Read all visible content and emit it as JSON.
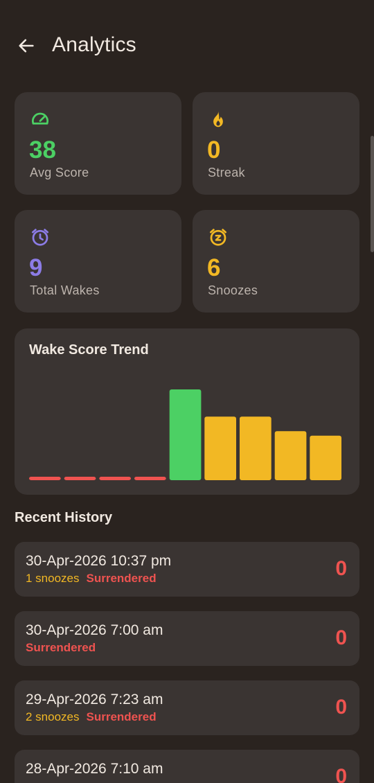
{
  "header": {
    "title": "Analytics"
  },
  "stats": [
    {
      "icon": "speedometer-icon",
      "value": "38",
      "label": "Avg Score",
      "color": "#4cd064"
    },
    {
      "icon": "flame-icon",
      "value": "0",
      "label": "Streak",
      "color": "#f2b824"
    },
    {
      "icon": "alarm-clock-icon",
      "value": "9",
      "label": "Total Wakes",
      "color": "#8c7ce6"
    },
    {
      "icon": "snooze-alarm-icon",
      "value": "6",
      "label": "Snoozes",
      "color": "#f2b824"
    }
  ],
  "chart_data": {
    "type": "bar",
    "title": "Wake Score Trend",
    "xlabel": "",
    "ylabel": "",
    "ylim": [
      0,
      100
    ],
    "grid": false,
    "values": [
      0,
      0,
      0,
      0,
      100,
      70,
      70,
      54,
      49
    ],
    "colors": [
      "#ef5350",
      "#ef5350",
      "#ef5350",
      "#ef5350",
      "#4cd064",
      "#f2b824",
      "#f2b824",
      "#f2b824",
      "#f2b824"
    ]
  },
  "history": {
    "title": "Recent History",
    "items": [
      {
        "date": "30-Apr-2026 10:37 pm",
        "snoozes": "1 snoozes",
        "status": "Surrendered",
        "score": "0"
      },
      {
        "date": "30-Apr-2026 7:00 am",
        "snoozes": "",
        "status": "Surrendered",
        "score": "0"
      },
      {
        "date": "29-Apr-2026 7:23 am",
        "snoozes": "2 snoozes",
        "status": "Surrendered",
        "score": "0"
      },
      {
        "date": "28-Apr-2026 7:10 am",
        "snoozes": "",
        "status": "",
        "score": "0"
      }
    ]
  },
  "colors": {
    "background": "#2a231f",
    "card": "#3a3432",
    "danger": "#ef5350",
    "warning": "#f2b824",
    "success": "#4cd064",
    "accent": "#8c7ce6"
  }
}
